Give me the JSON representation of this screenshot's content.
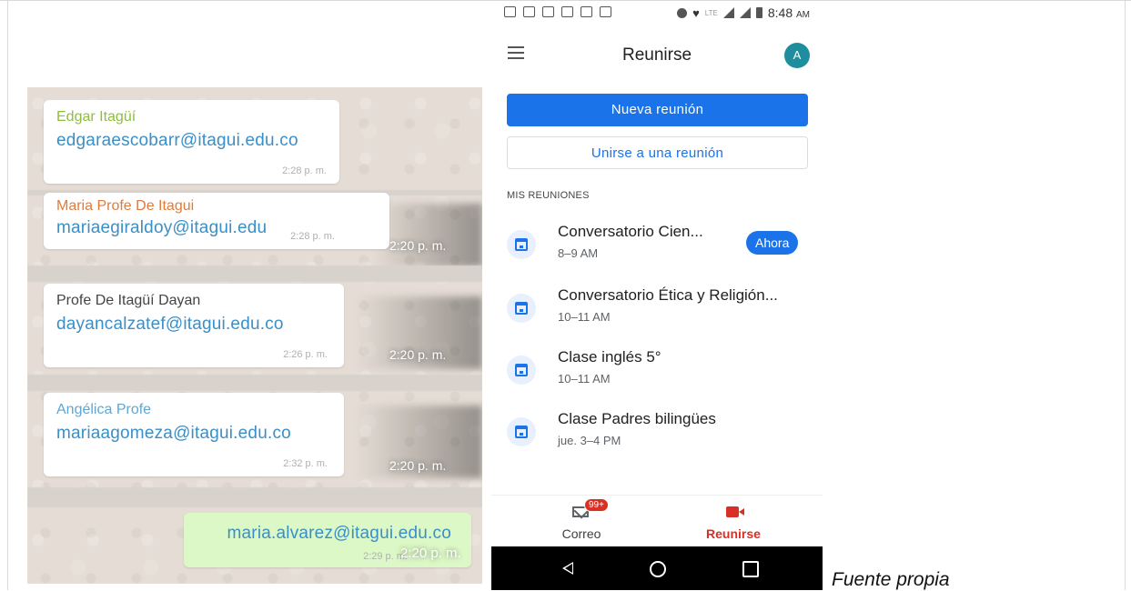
{
  "chat": {
    "messages": [
      {
        "sender": "Edgar Itagüí",
        "email": "edgaraescobarr@itagui.edu.co",
        "time": "2:28 p. m.",
        "sender_color": "#8dbf3d"
      },
      {
        "sender": "Maria Profe De Itagui",
        "email": "mariaegiraldoy@itagui.edu",
        "time": "2:28 p. m.",
        "ghost_time": "2:20 p. m.",
        "sender_color": "#e07b3c"
      },
      {
        "sender": "Profe De Itagüí Dayan",
        "email": "dayancalzatef@itagui.edu.co",
        "time": "2:26 p. m.",
        "ghost_time": "2:20 p. m.",
        "sender_color": "#444444"
      },
      {
        "sender": "Angélica Profe",
        "email": "mariaagomeza@itagui.edu.co",
        "time": "2:32 p. m.",
        "ghost_time": "2:20 p. m.",
        "sender_color": "#5fa7d1"
      },
      {
        "sender": "",
        "email": "maria.alvarez@itagui.edu.co",
        "time": "2:29 p. m.",
        "ghost_time": "2:20 p. m."
      }
    ]
  },
  "phone": {
    "status": {
      "network": "LTE",
      "time": "8:48",
      "ampm": "AM"
    },
    "appbar": {
      "title": "Reunirse",
      "avatar_letter": "A",
      "menu_icon": "hamburger-icon"
    },
    "buttons": {
      "new_meeting": "Nueva reunión",
      "join_meeting": "Unirse a una reunión"
    },
    "section_label": "MIS REUNIONES",
    "meetings": [
      {
        "title": "Conversatorio  Cien...",
        "time": "8–9 AM",
        "badge": "Ahora"
      },
      {
        "title": "Conversatorio Ética y Religión...",
        "time": "10–11 AM"
      },
      {
        "title": "Clase inglés 5°",
        "time": "10–11 AM"
      },
      {
        "title": "Clase Padres bilingües",
        "time": "jue. 3–4 PM"
      }
    ],
    "bottom_nav": {
      "mail": {
        "label": "Correo",
        "badge": "99+"
      },
      "meet": {
        "label": "Reunirse"
      }
    },
    "colors": {
      "primary": "#1a73e8",
      "accent_red": "#d93025",
      "avatar": "#1e8e9e"
    }
  },
  "caption": "Fuente propia"
}
